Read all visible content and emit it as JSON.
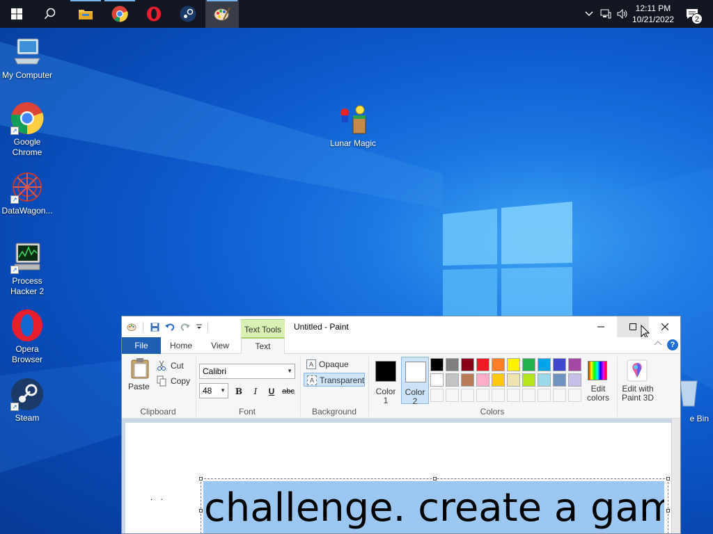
{
  "taskbar": {
    "time": "12:11 PM",
    "date": "10/21/2022",
    "notification_count": "2",
    "pinned": [
      "windows-start",
      "search",
      "file-explorer",
      "google-chrome",
      "opera",
      "steam",
      "paint"
    ]
  },
  "desktop": {
    "icons": [
      {
        "label": "My Computer"
      },
      {
        "label": "Google Chrome"
      },
      {
        "label": "DataWagon..."
      },
      {
        "label": "Process Hacker 2"
      },
      {
        "label": "Opera Browser"
      },
      {
        "label": "Steam"
      },
      {
        "label": "Lunar Magic"
      },
      {
        "label": "e Bin"
      }
    ]
  },
  "paint": {
    "title": "Untitled - Paint",
    "context_tab": "Text Tools",
    "tabs": [
      "File",
      "Home",
      "View",
      "Text"
    ],
    "active_tab": "Text",
    "clipboard": {
      "paste": "Paste",
      "cut": "Cut",
      "copy": "Copy",
      "label": "Clipboard"
    },
    "font": {
      "family": "Calibri",
      "size": "48",
      "bold": "B",
      "italic": "I",
      "underline": "U",
      "strike": "abc",
      "label": "Font"
    },
    "background": {
      "opaque": "Opaque",
      "transparent": "Transparent",
      "label": "Background",
      "selected": "Transparent"
    },
    "colors": {
      "color1_label": "Color\n1",
      "color1_l1": "Color",
      "color1_l2": "1",
      "color2_l1": "Color",
      "color2_l2": "2",
      "color1": "#000000",
      "color2": "#ffffff",
      "edit_colors_l1": "Edit",
      "edit_colors_l2": "colors",
      "paint3d_l1": "Edit with",
      "paint3d_l2": "Paint 3D",
      "label": "Colors",
      "palette_row1": [
        "#000000",
        "#7f7f7f",
        "#880015",
        "#ed1c24",
        "#ff7f27",
        "#fff200",
        "#22b14c",
        "#00a2e8",
        "#3f48cc",
        "#a349a4"
      ],
      "palette_row2": [
        "#ffffff",
        "#c3c3c3",
        "#b97a57",
        "#ffaec9",
        "#ffc90e",
        "#efe4b0",
        "#b5e61d",
        "#99d9ea",
        "#7092be",
        "#c8bfe7"
      ]
    },
    "canvas_text": "challenge. create a game",
    "canvas_dots": ". ."
  }
}
